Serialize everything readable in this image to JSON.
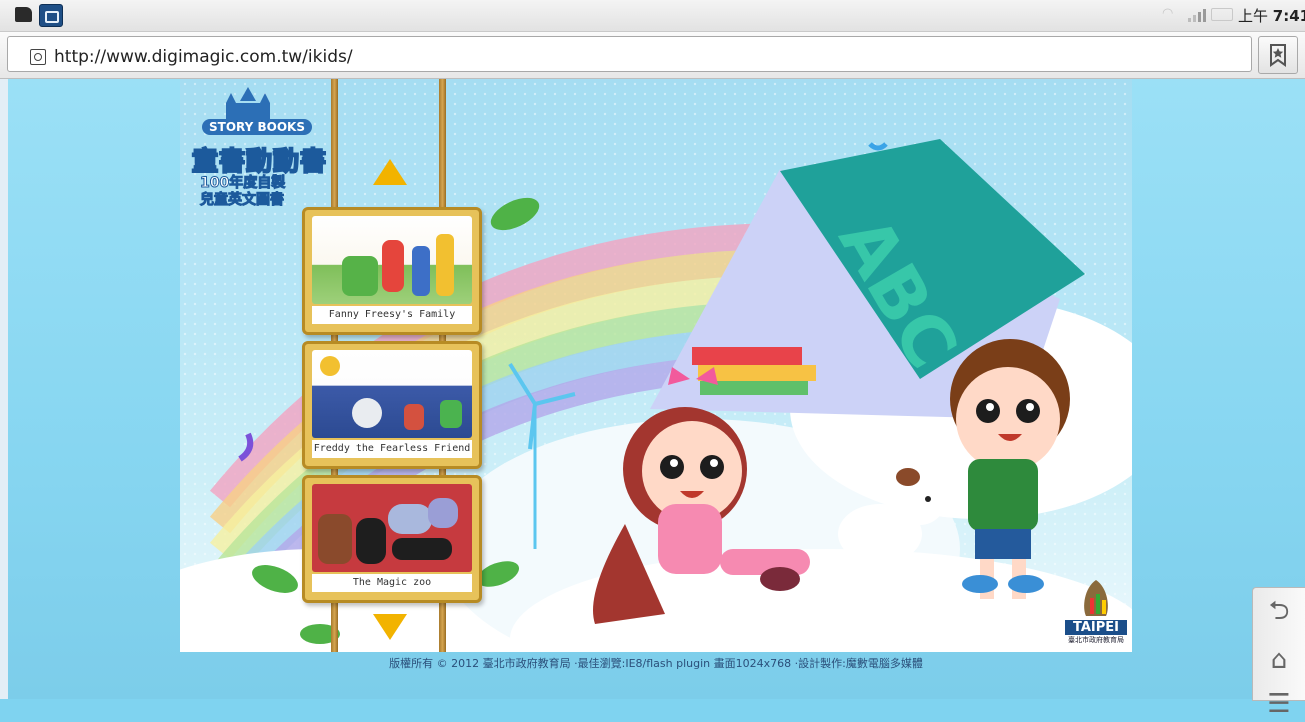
{
  "status_bar": {
    "time_prefix": "上午",
    "time": "7:41",
    "icons": [
      "sd-card-icon",
      "camera-icon",
      "wifi-icon",
      "signal-icon",
      "battery-icon"
    ]
  },
  "browser": {
    "url": "http://www.digimagic.com.tw/ikids/",
    "bookmark_icon": "bookmark-icon"
  },
  "page": {
    "logo": {
      "badge": "STORY BOOKS",
      "title": "童書動動書",
      "subtitle_line1": "100年度自製",
      "subtitle_line2": "兒童英文圖書"
    },
    "books": [
      {
        "title": "Fanny Freesy's Family"
      },
      {
        "title": "Freddy the Fearless Friend"
      },
      {
        "title": "The Magic zoo"
      }
    ],
    "taipei_logo": {
      "name": "TAIPEI",
      "org": "臺北市政府教育局"
    },
    "book_cover_letters": "ABC",
    "footer": "版權所有 © 2012 臺北市政府教育局 ·最佳瀏覽:IE8/flash plugin 畫面1024x768 ·設計製作:魔數電腦多媒體"
  },
  "side_nav": {
    "icons": [
      "back-icon",
      "home-icon",
      "menu-icon"
    ]
  },
  "colors": {
    "background": "#7fd3f0",
    "arrow": "#f2b300",
    "pole": "#c8973e",
    "book_frame": "#e7c25a"
  }
}
